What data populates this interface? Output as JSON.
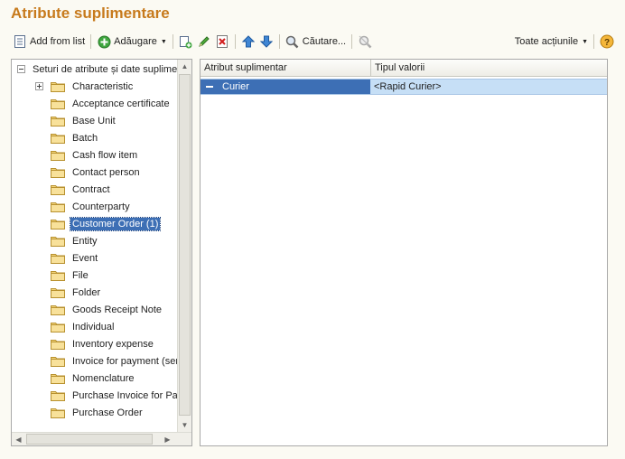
{
  "window": {
    "title": "Atribute suplimentare"
  },
  "toolbar": {
    "add_from_list": "Add from list",
    "add": "Adăugare",
    "search": "Căutare...",
    "all_actions": "Toate acțiunile",
    "help": "?"
  },
  "tree": {
    "root": "Seturi de atribute și date suplimentare",
    "items": [
      {
        "label": "Characteristic",
        "expandable": true
      },
      {
        "label": "Acceptance certificate"
      },
      {
        "label": "Base Unit"
      },
      {
        "label": "Batch"
      },
      {
        "label": "Cash flow item"
      },
      {
        "label": "Contact person"
      },
      {
        "label": "Contract"
      },
      {
        "label": "Counterparty"
      },
      {
        "label": "Customer Order (1)",
        "selected": true
      },
      {
        "label": "Entity"
      },
      {
        "label": "Event"
      },
      {
        "label": "File"
      },
      {
        "label": "Folder"
      },
      {
        "label": "Goods Receipt Note"
      },
      {
        "label": "Individual"
      },
      {
        "label": "Inventory expense"
      },
      {
        "label": "Invoice for payment (sending)"
      },
      {
        "label": "Nomenclature"
      },
      {
        "label": "Purchase Invoice for Payment"
      },
      {
        "label": "Purchase Order"
      }
    ]
  },
  "grid": {
    "columns": [
      "Atribut suplimentar",
      "Tipul valorii"
    ],
    "rows": [
      {
        "attribute": "Curier",
        "type": "<Rapid Curier>"
      }
    ]
  },
  "colors": {
    "title": "#c77a1c",
    "selection": "#3d6fb5",
    "row_highlight": "#c6dff6",
    "background": "#fbfaf3"
  }
}
